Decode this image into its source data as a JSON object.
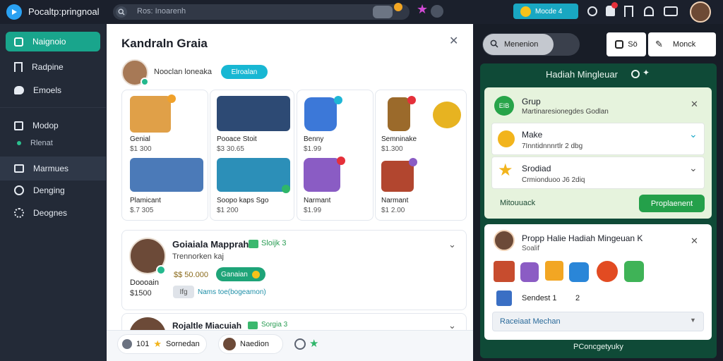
{
  "app": {
    "title": "Pocaltp:pringnoal"
  },
  "search": {
    "placeholder": "Ros: Inoarenh"
  },
  "header": {
    "coins_label": "Mocde 4"
  },
  "sidebar": {
    "items": [
      {
        "label": "Naignoio",
        "icon": "home-icon"
      },
      {
        "label": "Radpine",
        "icon": "bookmark-icon"
      },
      {
        "label": "Emoels",
        "icon": "chat-icon"
      },
      {
        "label": "Modop",
        "icon": "list-icon"
      },
      {
        "label": "Rlenat",
        "icon": "dot-icon"
      },
      {
        "label": "Marmues",
        "icon": "messages-icon"
      },
      {
        "label": "Denging",
        "icon": "globe-icon"
      },
      {
        "label": "Deognes",
        "icon": "settings-icon"
      }
    ]
  },
  "dialog": {
    "title": "Kandraln Graia",
    "user_name": "Nooclan loneaka",
    "user_badge": "Elroalan",
    "gifts": [
      {
        "name": "Genial",
        "price": "$1 300"
      },
      {
        "name": "Pooace Stoit",
        "price": "$3 30.65"
      },
      {
        "name": "Benny",
        "price": "$1.99"
      },
      {
        "name": "Semninake",
        "price": "$1.300"
      },
      {
        "name": "Plamicant",
        "price": "$.7 305"
      },
      {
        "name": "Soopo kaps Sgo",
        "price": "$1 200"
      },
      {
        "name": "Narmant",
        "price": "$1.99"
      },
      {
        "name": "Narmant",
        "price": "$1 2.00"
      }
    ],
    "person1": {
      "name": "Goiaiala Mapprah",
      "tag_label": "Sloijk 3",
      "sub": "Trennorken kaj",
      "role": "Doooain",
      "price": "$$ 50.000",
      "status_label": "Ganaian",
      "amount": "$1500",
      "mini_tag": "Ifg",
      "note": "Nams toe(bogeamon)"
    },
    "person2": {
      "name": "Rojaltle Miacuiah",
      "tag_label": "Sorgia 3"
    },
    "footer": {
      "stat_count": "101",
      "stat_label": "Sornedan",
      "user_label": "Naedion"
    }
  },
  "right": {
    "search_label": "Menenion",
    "btn1_label": "Sö",
    "btn2_label": "Monck",
    "panel_title": "Hadiah Mingleuar",
    "group": {
      "badge": "EIB",
      "title": "Grup",
      "sub": "Martinaresionegdes Godlan",
      "items": [
        {
          "title": "Make",
          "sub": "7Inntidnnnrtlr 2 dbg"
        },
        {
          "title": "Srodiad",
          "sub": "Crmionduoo J6 2diq"
        }
      ],
      "left_label": "Mitouuack",
      "action_label": "Proplaenent"
    },
    "card2": {
      "title": "Propp Halie Hadiah Mingeuan K",
      "sub": "Soalif",
      "footer_text": "Sendest 1",
      "footer_num": "2",
      "select_label": "Raceiaat Mechan"
    },
    "bottom_label": "PConcgetyuky"
  }
}
